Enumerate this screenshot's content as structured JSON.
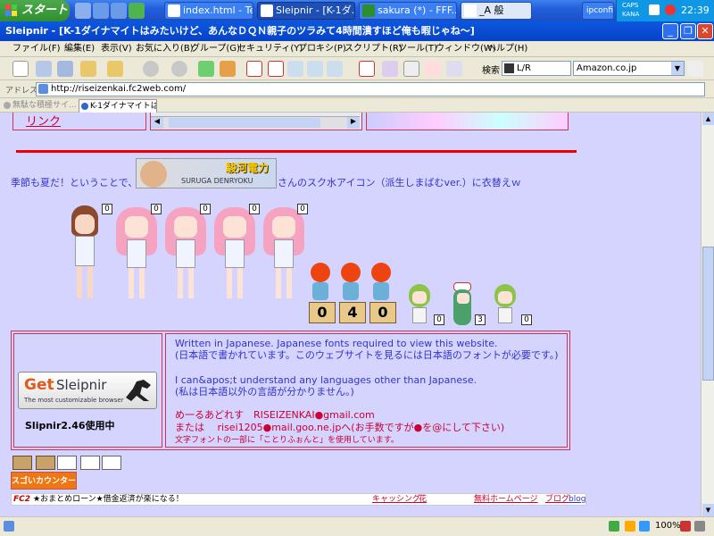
{
  "taskbar": {
    "start_label": "スタート",
    "buttons": [
      {
        "label": "index.html - Ter..."
      },
      {
        "label": "Sleipnir - [K-1ダ..."
      },
      {
        "label": "sakura (*) - FFF..."
      },
      {
        "label": "_A 般"
      },
      {
        "label": "ipconfig"
      }
    ],
    "tray_caps": "CAPS",
    "tray_kana": "KANA",
    "clock": "22:39"
  },
  "window": {
    "title": "Sleipnir - [K-1ダイナマイトはみたいけど、あんなＤＱＮ親子のツラみて4時間潰すほど俺も暇じゃね～]"
  },
  "menu": [
    "ファイル(F)",
    "編集(E)",
    "表示(V)",
    "お気に入り(B)",
    "グループ(G)",
    "セキュリティ(Y)",
    "プロキシ(P)",
    "スクリプト(R)",
    "ツール(T)",
    "ウィンドウ(W)",
    "ヘルプ(H)"
  ],
  "toolbar": {
    "search_label": "検索",
    "search_value": "L/R",
    "search_engine": "Amazon.co.jp"
  },
  "address": {
    "label": "アドレス",
    "url": "http://riseizenkai.fc2web.com/"
  },
  "tabs": [
    {
      "label": "無駄な積極サイ..."
    },
    {
      "label": "K-1ダイナマイトは..."
    }
  ],
  "page": {
    "link_top": "リンク",
    "intro_text": "季節も夏だ！ということで、",
    "intro_text2": "さんのスク水アイコン（派生しまばむver.）に衣替えｗ",
    "banner_title": "駿河電力",
    "banner_sub": "SURUGA DENRYOKU",
    "counter_digits": [
      "0",
      "4",
      "0"
    ],
    "small_counts": [
      "0",
      "0",
      "0",
      "0",
      "0"
    ],
    "chibi_counts": [
      "0",
      "3",
      "0"
    ],
    "get_label": "Get",
    "sleipnir_label": "Sleipnir",
    "sleipnir_tag": "The most customizable browser",
    "sleipnir_version": "Slipnir2.46使用中",
    "lines": [
      "Written in Japanese. Japanese fonts required to view this website.",
      "(日本語で書かれています。このウェブサイトを見るには日本語のフォントが必要です。)",
      "I can&apos;t understand any languages other than Japanese.",
      "(私は日本語以外の言語が分かりません。)",
      "め一るあどれす　RISEIZENKAI●gmail.com",
      "または　 risei1205●mail.goo.ne.jpへ(お手数ですが●を@にして下さい)",
      "文字フォントの一部に「ことりふぉんと」を使用しています。"
    ],
    "sugoi_counter": "スゴいカウンター",
    "footer_fc2": "FC2",
    "footer_ad": "★おまとめローン★借金返済が楽になる！",
    "footer_link1": "キャッシング",
    "footer_link2": "花",
    "footer_link3": "無料ホームページ",
    "footer_link4": "ブログ",
    "footer_link5": "blog"
  },
  "statusbar": {
    "zoom": "100%"
  },
  "colors": {
    "page_bg": "#d4d4ff",
    "accent_red": "#ee0000",
    "text_blue": "#3333cc",
    "text_red": "#cc0033"
  }
}
